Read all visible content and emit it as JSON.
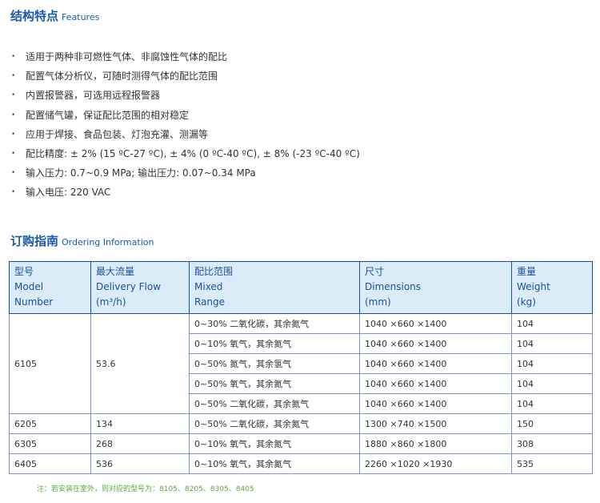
{
  "features": {
    "title_zh": "结构特点",
    "title_en": "Features",
    "bullet": "•",
    "items": [
      "适用于两种非可燃性气体、非腐蚀性气体的配比",
      "配置气体分析仪，可随时测得气体的配比范围",
      "内置报警器，可选用远程报警器",
      "配置储气罐，保证配比范围的相对稳定",
      "应用于焊接、食品包装、灯泡充灌、测漏等",
      "配比精度: ± 2% (15 ºC-27 ºC), ± 4% (0 ºC-40 ºC), ± 8% (-23 ºC-40 ºC)",
      "输入压力: 0.7~0.9 MPa; 输出压力: 0.07~0.34 MPa",
      "输入电压: 220 VAC"
    ]
  },
  "ordering": {
    "title_zh": "订购指南",
    "title_en": "Ordering Information",
    "headers": {
      "model": [
        "型号",
        "Model",
        "Number"
      ],
      "flow": [
        "最大流量",
        "Delivery Flow",
        "(m³/h)"
      ],
      "range": [
        "配比范围",
        "Mixed",
        "Range"
      ],
      "dimensions": [
        "尺寸",
        "Dimensions",
        "(mm)"
      ],
      "weight": [
        "重量",
        "Weight",
        "(kg)"
      ]
    },
    "rows": [
      {
        "model": "6105",
        "flow": "53.6",
        "range": "0~30% 二氧化碳，其余氮气",
        "dimensions": "1040 ×660 ×1400",
        "weight": "104"
      },
      {
        "range": "0~10% 氧气，其余氮气",
        "dimensions": "1040 ×660 ×1400",
        "weight": "104"
      },
      {
        "range": "0~50% 氮气，其余氢气",
        "dimensions": "1040 ×660 ×1400",
        "weight": "104"
      },
      {
        "range": "0~50% 氧气，其余氮气",
        "dimensions": "1040 ×660 ×1400",
        "weight": "104"
      },
      {
        "range": "0~50% 二氧化碳，其余氮气",
        "dimensions": "1040 ×660 ×1400",
        "weight": "104"
      },
      {
        "model": "6205",
        "flow": "134",
        "range": "0~50% 二氧化碳，其余氮气",
        "dimensions": "1300 ×740 ×1500",
        "weight": "150"
      },
      {
        "model": "6305",
        "flow": "268",
        "range": "0~10% 氧气，其余氮气",
        "dimensions": "1880 ×860 ×1800",
        "weight": "308"
      },
      {
        "model": "6405",
        "flow": "536",
        "range": "0~10% 氧气，其余氮气",
        "dimensions": "2260 ×1020 ×1930",
        "weight": "535"
      }
    ],
    "note": "注：若安装在室外，则对应的型号为：8105、8205、8305、8405"
  },
  "colors": {
    "title_blue": "#1a5aa8",
    "header_bg": "#d9ecf7",
    "header_text": "#1f4fa0",
    "note_green": "#5aab3a"
  }
}
